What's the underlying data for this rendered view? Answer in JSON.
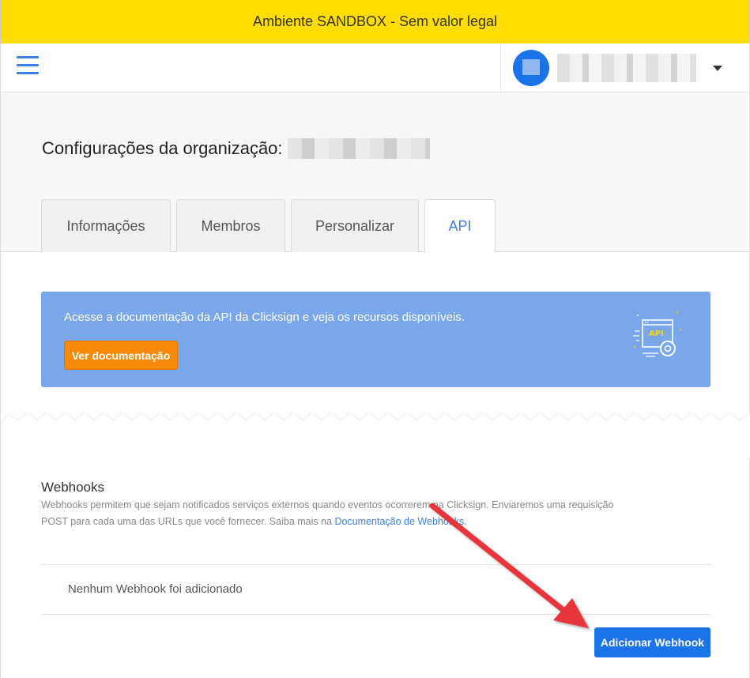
{
  "sandbox": {
    "text": "Ambiente SANDBOX - Sem valor legal"
  },
  "organization": {
    "title": "Configurações da organização:"
  },
  "tabs": [
    {
      "label": "Informações"
    },
    {
      "label": "Membros"
    },
    {
      "label": "Personalizar"
    },
    {
      "label": "API"
    }
  ],
  "banner": {
    "text": "Acesse a documentação da API da Clicksign e veja os recursos disponíveis.",
    "button_label": "Ver documentação",
    "illustration_label": "API"
  },
  "webhooks": {
    "title": "Webhooks",
    "description_line1": "Webhooks permitem que sejam notificados serviços externos quando eventos ocorrerem na Clicksign. Enviaremos uma requisição",
    "description_line2": "POST para cada uma das URLs que você fornecer. Saiba mais na ",
    "link_text": "Documentação de Webhooks",
    "link_suffix": ".",
    "empty_message": "Nenhum Webhook foi adicionado",
    "add_button": "Adicionar Webhook"
  },
  "colors": {
    "sandbox_bar": "#ffdd00",
    "accent": "#1a73e8",
    "banner": "#7aa7ea",
    "doc_button": "#f88a0a",
    "annotation_arrow": "#e8353a"
  }
}
